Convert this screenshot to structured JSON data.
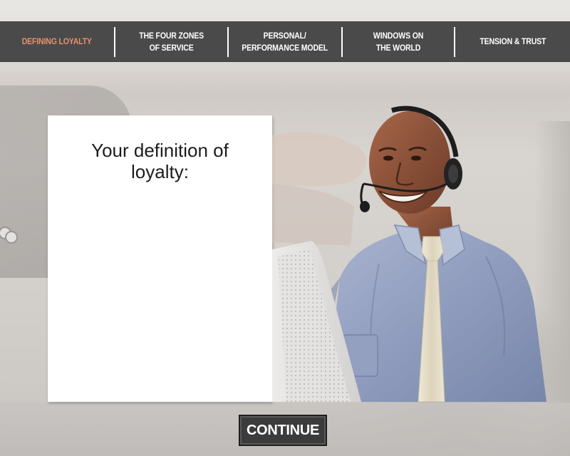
{
  "nav": {
    "tabs": [
      {
        "label": "DEFINING LOYALTY",
        "active": true
      },
      {
        "label": "THE FOUR ZONES\nOF SERVICE",
        "active": false
      },
      {
        "label": "PERSONAL/\nPERFORMANCE MODEL",
        "active": false
      },
      {
        "label": "WINDOWS ON\nTHE WORLD",
        "active": false
      },
      {
        "label": "TENSION & TRUST",
        "active": false
      }
    ],
    "active_color": "#e8906c",
    "background_color": "#4a4a4a"
  },
  "card": {
    "heading": "Your definition of\nloyalty:"
  },
  "continue_button": {
    "label": "CONTINUE"
  }
}
